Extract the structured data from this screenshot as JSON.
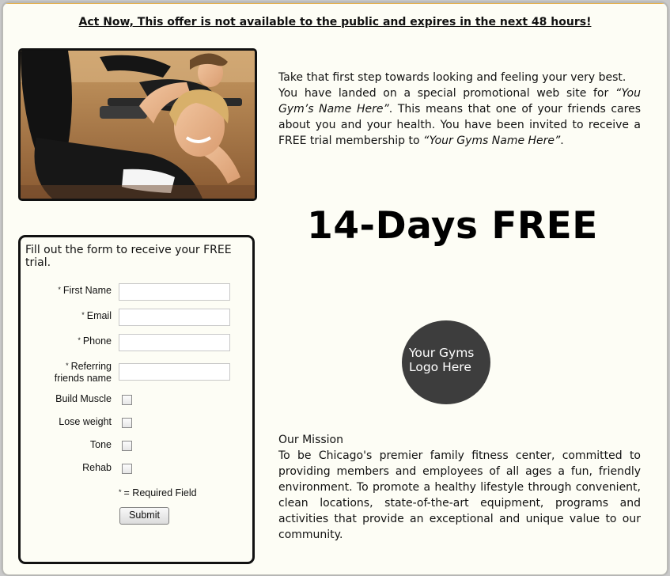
{
  "headline": "Act Now, This offer is not available to the public and expires in the next 48 hours!",
  "intro": {
    "line1": "Take that first step towards looking and feeling your very best.",
    "part_a": "You have landed on a special promotional web site for ",
    "gym_name_1": "“You Gym’s Name Here”",
    "part_b": ". This means that one of your friends cares about you and your health. You have been invited to receive a FREE trial membership to ",
    "gym_name_2": "“Your Gyms Name Here”",
    "part_c": "."
  },
  "offer": "14-Days FREE",
  "form": {
    "title": "Fill out the form to receive your FREE trial.",
    "required_mark": "*",
    "first_name_label": "First Name",
    "email_label": "Email",
    "phone_label": "Phone",
    "referring_label_1": "Referring",
    "referring_label_2": "friends name",
    "build_muscle_label": "Build Muscle",
    "lose_weight_label": "Lose weight",
    "tone_label": "Tone",
    "rehab_label": "Rehab",
    "required_note": "= Required Field",
    "submit_label": "Submit"
  },
  "logo": {
    "line1": "Your Gyms",
    "line2": "Logo Here"
  },
  "mission": {
    "title": "Our Mission",
    "text": "To be Chicago's premier family fitness center, committed to providing members and employees of all ages a fun, friendly environment. To promote a healthy lifestyle through convenient, clean locations, state-of-the-art equipment, programs and activities that provide an exceptional and unique value to our community."
  },
  "colors": {
    "page_background": "#fdfdf5",
    "logo_circle": "#3d3d3d",
    "top_accent": "#e6b04a"
  }
}
